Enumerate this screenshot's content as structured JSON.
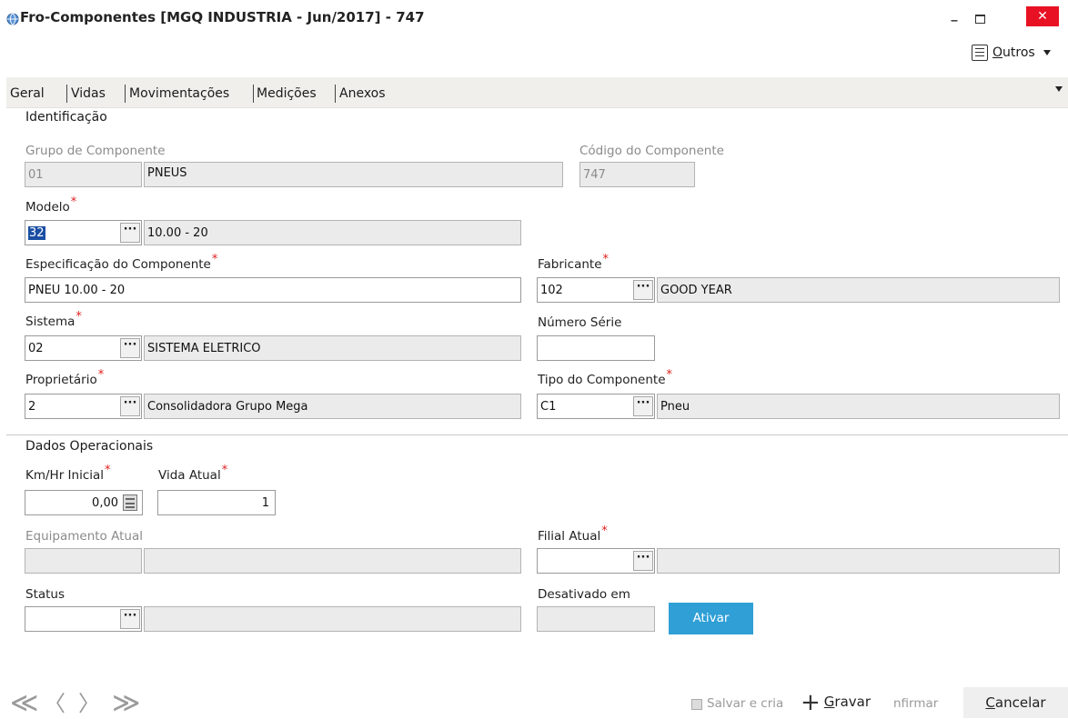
{
  "window": {
    "title": "Fro-Componentes [MGQ INDUSTRIA - Jun/2017]  - 747",
    "min_label": "_",
    "close_label": "✕"
  },
  "toolbar": {
    "outros_label": "Outros",
    "outros_icon": "list-icon"
  },
  "tabs": [
    {
      "label": "Geral",
      "active": true
    },
    {
      "label": "Vidas"
    },
    {
      "label": "Movimentações"
    },
    {
      "label": "Medições"
    },
    {
      "label": "Anexos"
    }
  ],
  "identificacao": {
    "section_title": "Identificação",
    "grupo": {
      "label": "Grupo de Componente",
      "code": "01",
      "desc": "PNEUS"
    },
    "codigo": {
      "label": "Código do Componente",
      "value": "747"
    },
    "modelo": {
      "label": "Modelo",
      "required": "*",
      "code": "32",
      "desc": "10.00 - 20"
    },
    "especificacao": {
      "label": "Especificação do Componente",
      "required": "*",
      "value": "PNEU 10.00 - 20"
    },
    "fabricante": {
      "label": "Fabricante",
      "required": "*",
      "code": "102",
      "desc": "GOOD YEAR"
    },
    "sistema": {
      "label": "Sistema",
      "required": "*",
      "code": "02",
      "desc": "SISTEMA ELETRICO"
    },
    "numero_serie": {
      "label": "Número Série",
      "value": ""
    },
    "proprietario": {
      "label": "Proprietário",
      "required": "*",
      "code": "2",
      "desc": "Consolidadora Grupo Mega"
    },
    "tipo": {
      "label": "Tipo do Componente",
      "required": "*",
      "code": "C1",
      "desc": "Pneu"
    }
  },
  "operacionais": {
    "section_title": "Dados Operacionais",
    "km_inicial": {
      "label": "Km/Hr Inicial",
      "required": "*",
      "value": "0,00"
    },
    "vida_atual": {
      "label": "Vida Atual",
      "required": "*",
      "value": "1"
    },
    "equipamento": {
      "label": "Equipamento Atual",
      "code": "",
      "desc": ""
    },
    "filial": {
      "label": "Filial Atual",
      "required": "*",
      "code": "",
      "desc": ""
    },
    "status": {
      "label": "Status",
      "code": "",
      "desc": ""
    },
    "desativado": {
      "label": "Desativado em",
      "value": ""
    },
    "ativar_label": "Ativar"
  },
  "footer": {
    "nav_first": "≪",
    "nav_prev": "〈",
    "nav_next": "〉",
    "nav_last": "≫",
    "salvar_cria": "Salvar e cria",
    "gravar_first": "G",
    "gravar_rest": "ravar",
    "confirmar_partial": "nfirmar",
    "cancelar_first": "C",
    "cancelar_rest": "ancelar"
  },
  "colors": {
    "accent": "#2f9fd6",
    "required": "#e01e1e",
    "close": "#e81123"
  }
}
